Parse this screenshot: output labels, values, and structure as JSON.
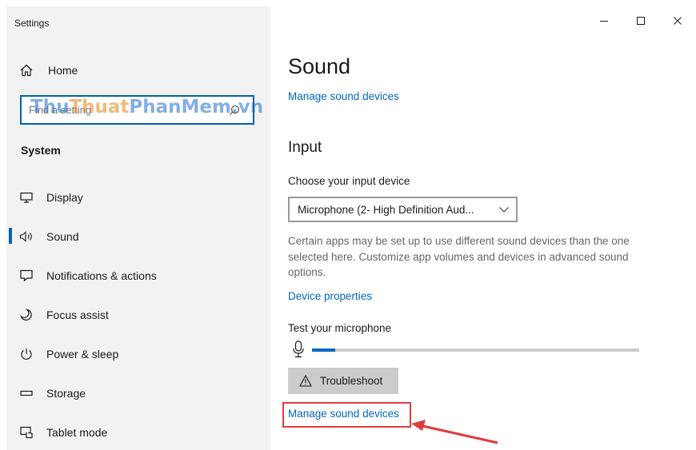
{
  "app": {
    "title": "Settings"
  },
  "sidebar": {
    "home_label": "Home",
    "search_placeholder": "Find a setting",
    "section_label": "System",
    "items": [
      {
        "label": "Display",
        "icon": "display-icon"
      },
      {
        "label": "Sound",
        "icon": "speaker-icon",
        "active": true
      },
      {
        "label": "Notifications & actions",
        "icon": "notification-icon"
      },
      {
        "label": "Focus assist",
        "icon": "moon-icon"
      },
      {
        "label": "Power & sleep",
        "icon": "power-icon"
      },
      {
        "label": "Storage",
        "icon": "storage-icon"
      },
      {
        "label": "Tablet mode",
        "icon": "tablet-mode-icon"
      }
    ]
  },
  "watermark": {
    "part1": "Thu",
    "part2": "Thuat",
    "part3": "PhanMem",
    "part4": ".vn"
  },
  "main": {
    "title": "Sound",
    "manage_link_top": "Manage sound devices",
    "input_heading": "Input",
    "choose_label": "Choose your input device",
    "input_device_selected": "Microphone (2- High Definition Aud...",
    "description": "Certain apps may be set up to use different sound devices than the one selected here. Customize app volumes and devices in advanced sound options.",
    "device_properties_link": "Device properties",
    "test_label": "Test your microphone",
    "mic_level": 0.07,
    "troubleshoot_label": "Troubleshoot",
    "manage_link_bottom": "Manage sound devices"
  },
  "colors": {
    "accent": "#0067c0",
    "highlight": "#e03c3c",
    "sidebar_bg": "#f2f2f2"
  }
}
